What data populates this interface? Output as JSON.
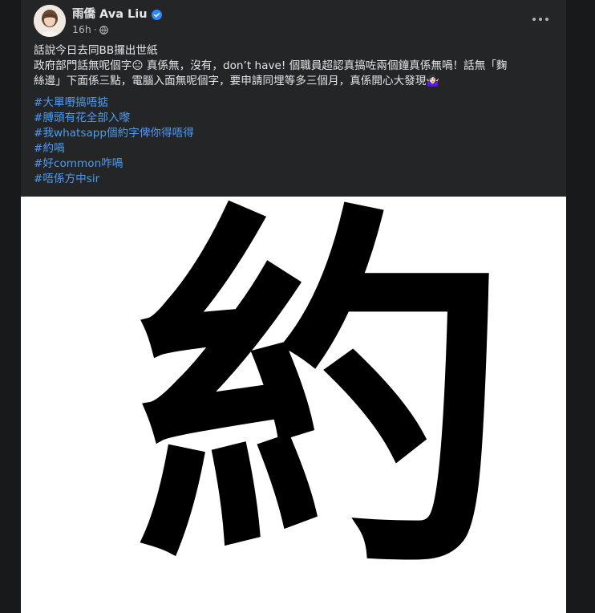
{
  "post": {
    "author": "雨僑 Ava Liu",
    "verified": true,
    "time": "16h",
    "separator": "·",
    "privacy_icon": "globe-icon",
    "more_icon": "more-options-icon",
    "text_lines": [
      "話說今日去同BB攞出世紙",
      "政府部門話無呢個字😐 真係無，沒有，don’t have! 個職員超認真搞咗兩個鐘真係無喎！話無「麴",
      "絲邊」下面係三點，電腦入面無呢個字，要申請同埋等多三個月，真係開心大發現🤷🏻‍♀️"
    ],
    "hashtags": [
      "#大單嘢搞唔掂",
      "#膊頭有花全部入嚟",
      "#我whatsapp個約字俾你得唔得",
      "#約喎",
      "#好common咋喎",
      "#唔係方中sir"
    ],
    "photo_text": "約"
  },
  "colors": {
    "page_bg": "#18191a",
    "card_bg": "#242526",
    "primary_text": "#e4e6eb",
    "secondary_text": "#b0b3b8",
    "hashtag": "#4e9bf5",
    "verified_badge": "#2d88ff"
  }
}
